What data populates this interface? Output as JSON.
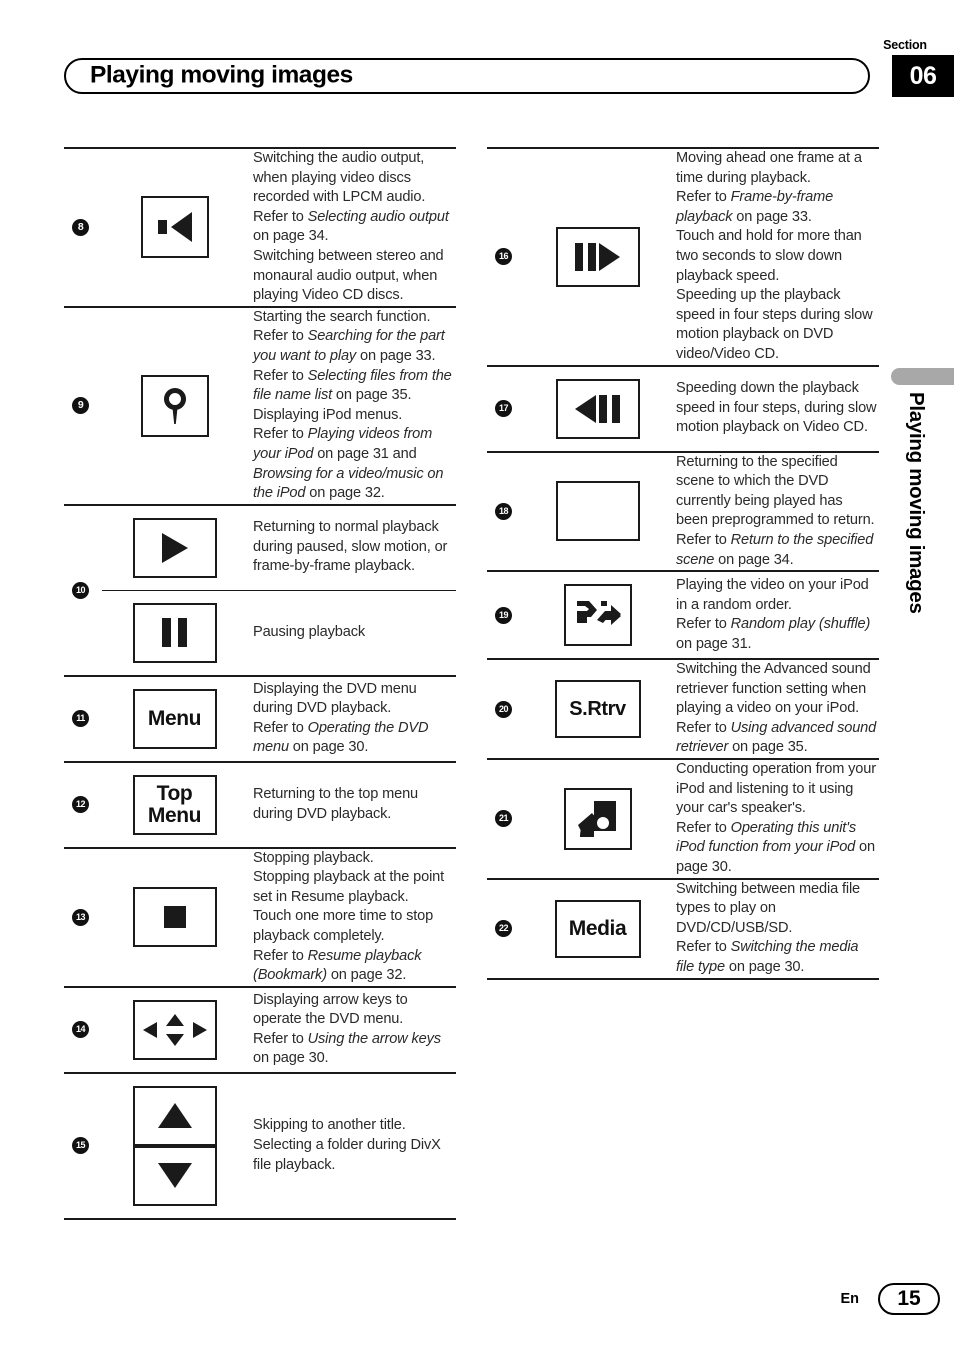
{
  "header": {
    "section_word": "Section",
    "section_number": "06",
    "title": "Playing moving images"
  },
  "side_tab": {
    "vertical_title": "Playing moving images"
  },
  "footer": {
    "language": "En",
    "page_number": "15"
  },
  "left_column": [
    {
      "number": "8",
      "icon": "speaker-audio-output-icon",
      "lines": [
        {
          "parts": [
            {
              "t": "Switching the audio output, when playing video discs recorded with LPCM audio.",
              "i": false
            }
          ]
        },
        {
          "parts": [
            {
              "t": "Refer to ",
              "i": false
            },
            {
              "t": "Selecting audio output",
              "i": true
            },
            {
              "t": " on page 34.",
              "i": false
            }
          ]
        },
        {
          "parts": [
            {
              "t": "Switching between stereo and monaural audio output, when playing Video CD discs.",
              "i": false
            }
          ]
        }
      ]
    },
    {
      "number": "9",
      "icon": "search-magnifier-icon",
      "lines": [
        {
          "parts": [
            {
              "t": "Starting the search function.",
              "i": false
            }
          ]
        },
        {
          "parts": [
            {
              "t": "Refer to ",
              "i": false
            },
            {
              "t": "Searching for the part you want to play",
              "i": true
            },
            {
              "t": " on page 33.",
              "i": false
            }
          ]
        },
        {
          "parts": [
            {
              "t": "Refer to ",
              "i": false
            },
            {
              "t": "Selecting files from the file name list",
              "i": true
            },
            {
              "t": " on page 35.",
              "i": false
            }
          ]
        },
        {
          "parts": [
            {
              "t": "Displaying iPod menus.",
              "i": false
            }
          ]
        },
        {
          "parts": [
            {
              "t": "Refer to ",
              "i": false
            },
            {
              "t": "Playing videos from your iPod",
              "i": true
            },
            {
              "t": " on page 31 and ",
              "i": false
            },
            {
              "t": "Browsing for a video/music on the iPod",
              "i": true
            },
            {
              "t": " on page 32.",
              "i": false
            }
          ]
        }
      ]
    },
    {
      "number": "10",
      "grouped": true,
      "subrows": [
        {
          "icon": "play-icon",
          "lines": [
            {
              "parts": [
                {
                  "t": "Returning to normal playback during paused, slow motion, or frame-by-frame playback.",
                  "i": false
                }
              ]
            }
          ]
        },
        {
          "icon": "pause-icon",
          "lines": [
            {
              "parts": [
                {
                  "t": "Pausing playback",
                  "i": false
                }
              ]
            }
          ]
        }
      ]
    },
    {
      "number": "11",
      "icon": "menu-button-icon",
      "icon_label": "Menu",
      "lines": [
        {
          "parts": [
            {
              "t": "Displaying the DVD menu during DVD playback.",
              "i": false
            }
          ]
        },
        {
          "parts": [
            {
              "t": "Refer to ",
              "i": false
            },
            {
              "t": "Operating the DVD menu",
              "i": true
            },
            {
              "t": " on page 30.",
              "i": false
            }
          ]
        }
      ]
    },
    {
      "number": "12",
      "icon": "top-menu-button-icon",
      "icon_label": "Top\nMenu",
      "lines": [
        {
          "parts": [
            {
              "t": "Returning to the top menu during DVD playback.",
              "i": false
            }
          ]
        }
      ]
    },
    {
      "number": "13",
      "icon": "stop-icon",
      "lines": [
        {
          "parts": [
            {
              "t": "Stopping playback.",
              "i": false
            }
          ]
        },
        {
          "parts": [
            {
              "t": "Stopping playback at the point set in Resume playback.",
              "i": false
            }
          ]
        },
        {
          "parts": [
            {
              "t": "Touch one more time to stop playback completely.",
              "i": false
            }
          ]
        },
        {
          "parts": [
            {
              "t": "Refer to ",
              "i": false
            },
            {
              "t": "Resume playback (Bookmark)",
              "i": true
            },
            {
              "t": " on page 32.",
              "i": false
            }
          ]
        }
      ]
    },
    {
      "number": "14",
      "icon": "four-direction-arrow-keys-icon",
      "lines": [
        {
          "parts": [
            {
              "t": "Displaying arrow keys to operate the DVD menu.",
              "i": false
            }
          ]
        },
        {
          "parts": [
            {
              "t": "Refer to ",
              "i": false
            },
            {
              "t": "Using the arrow keys",
              "i": true
            },
            {
              "t": " on page 30.",
              "i": false
            }
          ]
        }
      ]
    },
    {
      "number": "15",
      "icon": "up-down-arrow-icon",
      "lines": [
        {
          "parts": [
            {
              "t": "Skipping to another title.",
              "i": false
            }
          ]
        },
        {
          "parts": [
            {
              "t": "Selecting a folder during DivX file playback.",
              "i": false
            }
          ]
        }
      ]
    }
  ],
  "right_column": [
    {
      "number": "16",
      "icon": "frame-forward-icon",
      "lines": [
        {
          "parts": [
            {
              "t": "Moving ahead one frame at a time during playback.",
              "i": false
            }
          ]
        },
        {
          "parts": [
            {
              "t": "Refer to ",
              "i": false
            },
            {
              "t": "Frame-by-frame playback",
              "i": true
            },
            {
              "t": " on page 33.",
              "i": false
            }
          ]
        },
        {
          "parts": [
            {
              "t": "Touch and hold for more than two seconds to slow down playback speed.",
              "i": false
            }
          ]
        },
        {
          "parts": [
            {
              "t": "Speeding up the playback speed in four steps during slow motion playback on DVD video/Video CD.",
              "i": false
            }
          ]
        }
      ]
    },
    {
      "number": "17",
      "icon": "frame-backward-icon",
      "lines": [
        {
          "parts": [
            {
              "t": "Speeding down the playback speed in four steps, during slow motion playback on Video CD.",
              "i": false
            }
          ]
        }
      ]
    },
    {
      "number": "18",
      "icon": "blank-return-icon",
      "lines": [
        {
          "parts": [
            {
              "t": "Returning to the specified scene to which the DVD currently being played has been preprogrammed to return.",
              "i": false
            }
          ]
        },
        {
          "parts": [
            {
              "t": "Refer to ",
              "i": false
            },
            {
              "t": "Return to the specified scene",
              "i": true
            },
            {
              "t": " on page 34.",
              "i": false
            }
          ]
        }
      ]
    },
    {
      "number": "19",
      "icon": "shuffle-random-icon",
      "lines": [
        {
          "parts": [
            {
              "t": "Playing the video on your iPod in a random order.",
              "i": false
            }
          ]
        },
        {
          "parts": [
            {
              "t": "Refer to ",
              "i": false
            },
            {
              "t": "Random play (shuffle)",
              "i": true
            },
            {
              "t": " on page 31.",
              "i": false
            }
          ]
        }
      ]
    },
    {
      "number": "20",
      "icon": "sound-retriever-button-icon",
      "icon_label": "S.Rtrv",
      "lines": [
        {
          "parts": [
            {
              "t": "Switching the Advanced sound retriever function setting when playing a video on your iPod.",
              "i": false
            }
          ]
        },
        {
          "parts": [
            {
              "t": "Refer to ",
              "i": false
            },
            {
              "t": "Using advanced sound retriever",
              "i": true
            },
            {
              "t": " on page 35.",
              "i": false
            }
          ]
        }
      ]
    },
    {
      "number": "21",
      "icon": "hand-holding-ipod-icon",
      "lines": [
        {
          "parts": [
            {
              "t": "Conducting operation from your iPod and listening to it using your car's speaker's.",
              "i": false
            }
          ]
        },
        {
          "parts": [
            {
              "t": "Refer to ",
              "i": false
            },
            {
              "t": "Operating this unit's iPod function from your iPod",
              "i": true
            },
            {
              "t": " on page 30.",
              "i": false
            }
          ]
        }
      ]
    },
    {
      "number": "22",
      "icon": "media-button-icon",
      "icon_label": "Media",
      "lines": [
        {
          "parts": [
            {
              "t": "Switching between media file types to play on DVD/CD/USB/SD.",
              "i": false
            }
          ]
        },
        {
          "parts": [
            {
              "t": "Refer to ",
              "i": false
            },
            {
              "t": "Switching the media file type",
              "i": true
            },
            {
              "t": " on page 30.",
              "i": false
            }
          ]
        }
      ]
    }
  ]
}
